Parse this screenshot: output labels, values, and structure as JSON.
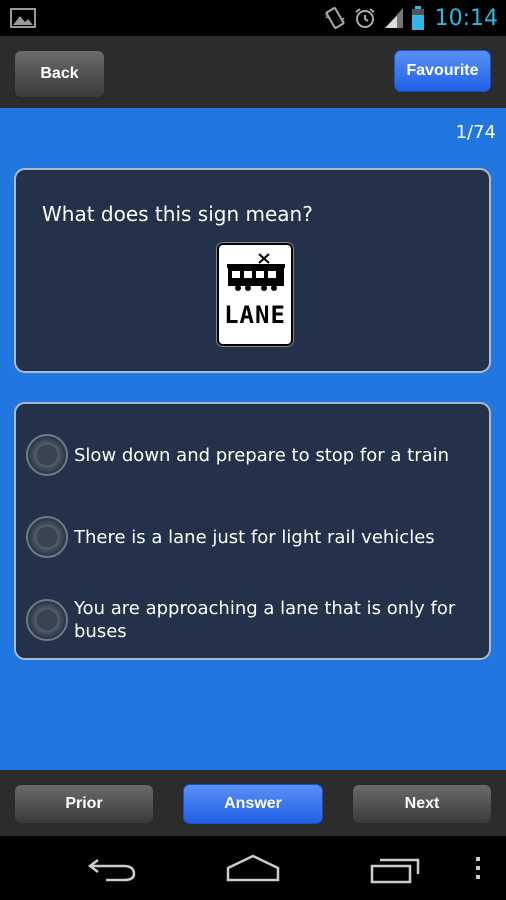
{
  "status_bar": {
    "time": "10:14",
    "icons": [
      "gallery-icon",
      "vibrate-icon",
      "alarm-icon",
      "signal-icon",
      "battery-icon"
    ]
  },
  "action_bar": {
    "back_label": "Back",
    "favourite_label": "Favourite"
  },
  "quiz": {
    "counter": "1/74",
    "question": "What does this sign mean?",
    "sign_text": "LANE",
    "options": [
      "Slow down and prepare to stop for a train",
      "There is a lane just for light rail vehicles",
      "You are approaching a lane that is only for buses"
    ]
  },
  "bottom_bar": {
    "prior_label": "Prior",
    "answer_label": "Answer",
    "next_label": "Next"
  },
  "nav_bar": {
    "icons": [
      "back-nav-icon",
      "home-nav-icon",
      "recent-apps-icon",
      "menu-icon"
    ]
  },
  "colors": {
    "background_blue": "#2176e0",
    "card": "#23324a",
    "accent_blue": "#2060e6",
    "clock": "#33b5e5"
  }
}
